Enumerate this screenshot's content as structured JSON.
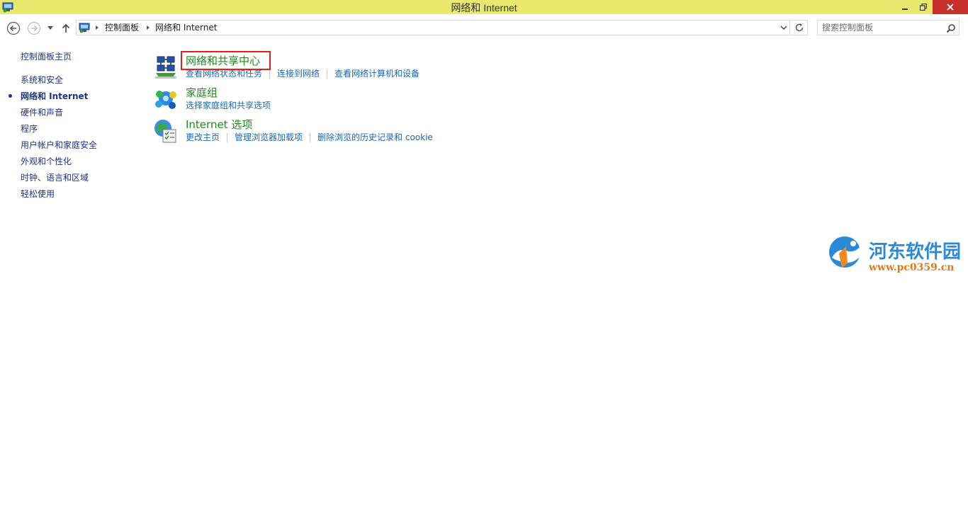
{
  "window": {
    "title": "网络和 Internet",
    "title_bar_color": "#e8e86c",
    "close_color": "#c7312b"
  },
  "nav": {
    "breadcrumb": [
      "控制面板",
      "网络和 Internet"
    ],
    "search_placeholder": "搜索控制面板"
  },
  "sidebar": {
    "home": "控制面板主页",
    "items": [
      {
        "label": "系统和安全",
        "active": false
      },
      {
        "label": "网络和 Internet",
        "active": true
      },
      {
        "label": "硬件和声音",
        "active": false
      },
      {
        "label": "程序",
        "active": false
      },
      {
        "label": "用户帐户和家庭安全",
        "active": false
      },
      {
        "label": "外观和个性化",
        "active": false
      },
      {
        "label": "时钟、语言和区域",
        "active": false
      },
      {
        "label": "轻松使用",
        "active": false
      }
    ]
  },
  "categories": [
    {
      "title": "网络和共享中心",
      "icon": "network-icon",
      "links": [
        "查看网络状态和任务",
        "连接到网络",
        "查看网络计算机和设备"
      ]
    },
    {
      "title": "家庭组",
      "icon": "homegroup-icon",
      "links": [
        "选择家庭组和共享选项"
      ]
    },
    {
      "title": "Internet 选项",
      "icon": "internet-options-icon",
      "links": [
        "更改主页",
        "管理浏览器加载项",
        "删除浏览的历史记录和 cookie"
      ]
    }
  ],
  "watermark": {
    "name": "河东软件园",
    "url": "www.pc0359.cn"
  },
  "colors": {
    "link": "#1a68b8",
    "category_title": "#1e8a1e",
    "sidebar_text": "#1e3287",
    "highlight_border": "#e02020"
  }
}
